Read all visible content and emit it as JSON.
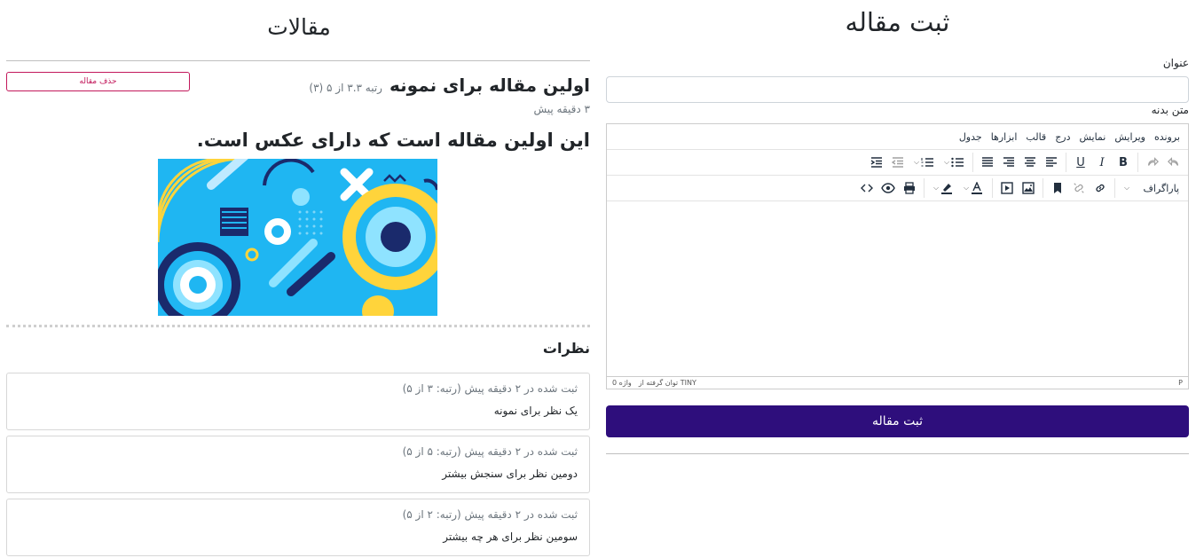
{
  "form": {
    "heading": "ثبت مقاله",
    "title_label": "عنوان",
    "title_value": "",
    "body_label": "متن بدنه",
    "submit_label": "ثبت مقاله"
  },
  "editor": {
    "menu": [
      "برونده",
      "ویرایش",
      "نمایش",
      "درج",
      "قالب",
      "ابزارها",
      "جدول"
    ],
    "format_select": "پاراگراف",
    "status_path": "P",
    "word_count": "0 واژه",
    "brand": "توان گرفته از TINY",
    "toolbar_icons": [
      "undo-icon",
      "redo-icon",
      "bold-icon",
      "italic-icon",
      "underline-icon",
      "align-left-icon",
      "align-center-icon",
      "align-right-icon",
      "align-justify-icon",
      "bullet-list-icon",
      "numbered-list-icon",
      "outdent-icon",
      "indent-icon",
      "link-icon",
      "unlink-icon",
      "bookmark-icon",
      "image-icon",
      "media-icon",
      "text-color-icon",
      "highlight-icon",
      "print-icon",
      "preview-icon",
      "code-icon"
    ]
  },
  "articles": {
    "heading": "مقالات",
    "delete_label": "حذف مقاله",
    "post": {
      "title": "اولین مقاله برای نمونه",
      "rating": "رتبه ۳.۳ از ۵ (۳)",
      "time": "۳ دقیقه پیش",
      "body": "این اولین مقاله است که دارای عکس است."
    },
    "comments_title": "نظرات",
    "comments": [
      {
        "meta": "ثبت شده در ۲ دقیقه پیش (رتبه: ۳ از ۵)",
        "text": "یک نظر برای نمونه"
      },
      {
        "meta": "ثبت شده در ۲ دقیقه پیش (رتبه: ۵ از ۵)",
        "text": "دومین نظر برای سنجش بیشتر"
      },
      {
        "meta": "ثبت شده در ۲ دقیقه پیش (رتبه: ۲ از ۵)",
        "text": "سومین نظر برای هر چه بیشتر"
      }
    ]
  },
  "colors": {
    "submit": "#2e0e7c",
    "delete": "#c2185b",
    "image_bg": "#1fb6f2",
    "image_yellow": "#ffd43b",
    "image_navy": "#1a2a6c"
  }
}
